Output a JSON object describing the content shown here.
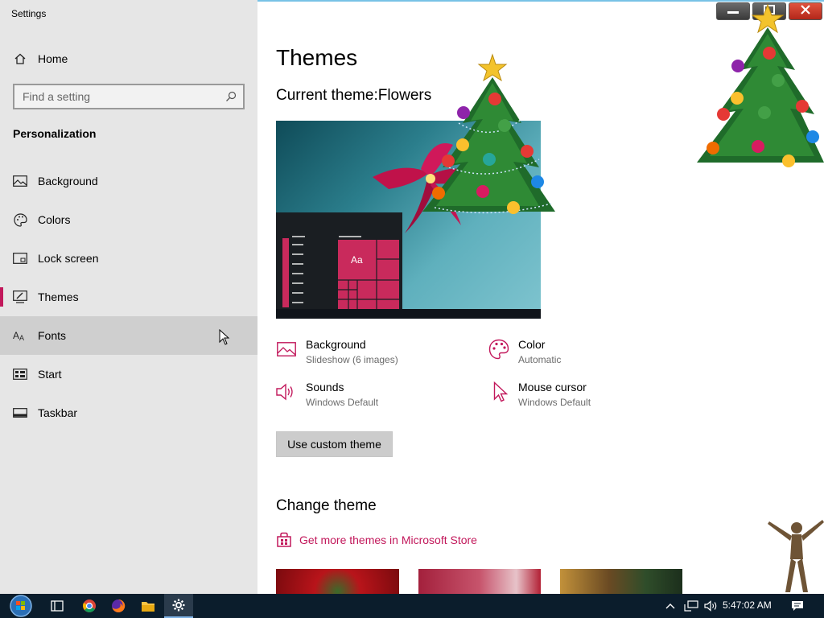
{
  "window": {
    "title": "Settings"
  },
  "sidebar": {
    "home_label": "Home",
    "search_placeholder": "Find a setting",
    "section_title": "Personalization",
    "items": [
      {
        "label": "Background",
        "icon": "image-icon"
      },
      {
        "label": "Colors",
        "icon": "palette-icon"
      },
      {
        "label": "Lock screen",
        "icon": "lock-screen-icon"
      },
      {
        "label": "Themes",
        "icon": "themes-icon",
        "selected": true
      },
      {
        "label": "Fonts",
        "icon": "fonts-icon",
        "hovered": true
      },
      {
        "label": "Start",
        "icon": "start-icon"
      },
      {
        "label": "Taskbar",
        "icon": "taskbar-icon"
      }
    ]
  },
  "main": {
    "title": "Themes",
    "current_theme_label": "Current theme:",
    "current_theme_name": "Flowers",
    "preview_tile_text": "Aa",
    "properties": [
      {
        "label": "Background",
        "value": "Slideshow (6 images)",
        "icon": "image-icon"
      },
      {
        "label": "Color",
        "value": "Automatic",
        "icon": "palette-icon"
      },
      {
        "label": "Sounds",
        "value": "Windows Default",
        "icon": "speaker-icon"
      },
      {
        "label": "Mouse cursor",
        "value": "Windows Default",
        "icon": "cursor-icon"
      }
    ],
    "custom_button": "Use custom theme",
    "change_title": "Change theme",
    "store_link": "Get more themes in Microsoft Store"
  },
  "taskbar": {
    "clock": "5:47:02 AM",
    "icons": [
      "start-orb-icon",
      "task-view-icon",
      "chrome-icon",
      "firefox-icon",
      "file-explorer-icon",
      "settings-gear-icon"
    ],
    "tray": [
      "chevron-up-icon",
      "network-icon",
      "volume-icon",
      "notification-icon"
    ]
  },
  "colors": {
    "accent": "#c2185b",
    "sidebar_bg": "#e6e6e6",
    "taskbar_bg": "#0b1d2c"
  }
}
